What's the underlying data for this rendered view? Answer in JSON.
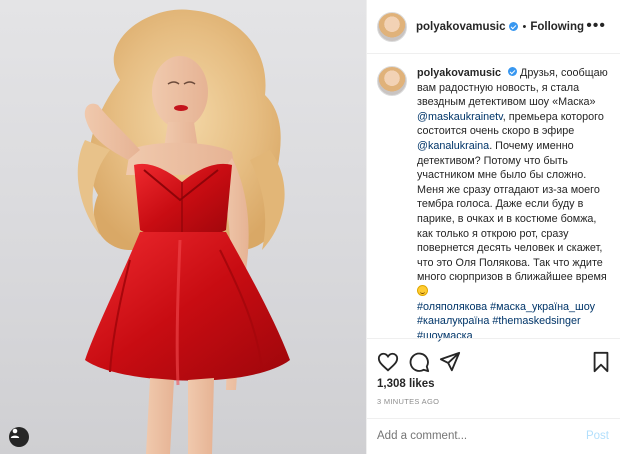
{
  "header": {
    "username": "polyakovamusic",
    "separator": "•",
    "follow_status": "Following",
    "more_label": "•••"
  },
  "caption": {
    "username": "polyakovamusic",
    "text_1": "Друзья, сообщаю вам радостную новость, я стала звездным детективом шоу «Маска» ",
    "mention_1": "@maskaukrainetv",
    "text_2": ", премьера которого состоится очень скоро в эфире ",
    "mention_2": "@kanalukraina",
    "text_3": ". Почему именно детективом? Потому что быть участником мне было бы сложно. Меня же сразу отгадают из-за моего тембра голоса. Даже если буду в парике, в очках и в костюме бомжа, как только я открою рот, сразу повернется десять человек и скажет, что это Оля Полякова. Так что ждите много сюрпризов в ближайшее время ",
    "hashtags": [
      "#оляполякова",
      "#маска_україна_шоу",
      "#каналукраїна",
      "#themaskedsinger",
      "#шоумаска"
    ]
  },
  "actions": {
    "like_icon": "heart-icon",
    "comment_icon": "comment-icon",
    "share_icon": "share-icon",
    "save_icon": "bookmark-icon"
  },
  "likes": "1,308 likes",
  "timestamp": "3 minutes ago",
  "comment": {
    "placeholder": "Add a comment...",
    "post_label": "Post"
  },
  "colors": {
    "dress": "#d7141a",
    "link": "#003569",
    "verified": "#3897f0",
    "post_disabled": "#b2dffc"
  }
}
